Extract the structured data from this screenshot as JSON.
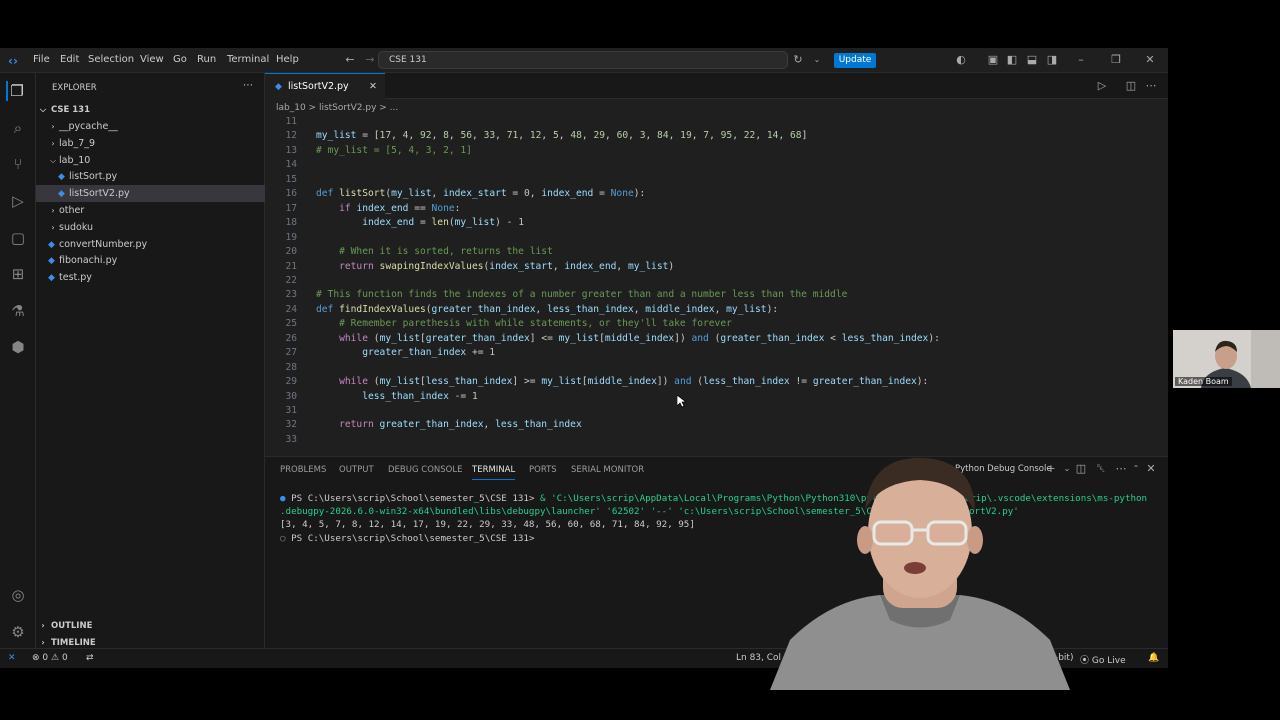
{
  "titlebar": {
    "menu": [
      "File",
      "Edit",
      "Selection",
      "View",
      "Go",
      "Run",
      "Terminal",
      "Help"
    ],
    "search_text": "CSE 131",
    "update_label": "Update"
  },
  "sidebar": {
    "header": "EXPLORER",
    "root": "CSE 131",
    "items": [
      {
        "label": "__pycache__",
        "kind": "folder",
        "open": false,
        "depth": 1
      },
      {
        "label": "lab_7_9",
        "kind": "folder",
        "open": false,
        "depth": 1
      },
      {
        "label": "lab_10",
        "kind": "folder",
        "open": true,
        "depth": 1
      },
      {
        "label": "listSort.py",
        "kind": "file",
        "depth": 2
      },
      {
        "label": "listSortV2.py",
        "kind": "file",
        "depth": 2,
        "selected": true
      },
      {
        "label": "other",
        "kind": "folder",
        "open": false,
        "depth": 1
      },
      {
        "label": "sudoku",
        "kind": "folder",
        "open": false,
        "depth": 1
      },
      {
        "label": "convertNumber.py",
        "kind": "file",
        "depth": 1
      },
      {
        "label": "fibonachi.py",
        "kind": "file",
        "depth": 1
      },
      {
        "label": "test.py",
        "kind": "file",
        "depth": 1
      }
    ],
    "outline": "OUTLINE",
    "timeline": "TIMELINE"
  },
  "editor": {
    "tab": "listSortV2.py",
    "breadcrumb": "lab_10 > listSortV2.py > ...",
    "lines": [
      {
        "n": "11",
        "code": ""
      },
      {
        "n": "12",
        "code": "my_list = [17, 4, 92, 8, 56, 33, 71, 12, 5, 48, 29, 60, 3, 84, 19, 7, 95, 22, 14, 68]"
      },
      {
        "n": "13",
        "code": "# my_list = [5, 4, 3, 2, 1]"
      },
      {
        "n": "14",
        "code": ""
      },
      {
        "n": "15",
        "code": ""
      },
      {
        "n": "16",
        "code": "def listSort(my_list, index_start = 0, index_end = None):"
      },
      {
        "n": "17",
        "code": "    if index_end == None:"
      },
      {
        "n": "18",
        "code": "        index_end = len(my_list) - 1"
      },
      {
        "n": "19",
        "code": ""
      },
      {
        "n": "20",
        "code": "    # When it is sorted, returns the list"
      },
      {
        "n": "21",
        "code": "    return swapingIndexValues(index_start, index_end, my_list)"
      },
      {
        "n": "22",
        "code": ""
      },
      {
        "n": "23",
        "code": "# This function finds the indexes of a number greater than and a number less than the middle"
      },
      {
        "n": "24",
        "code": "def findIndexValues(greater_than_index, less_than_index, middle_index, my_list):"
      },
      {
        "n": "25",
        "code": "    # Remember parethesis with while statements, or they'll take forever"
      },
      {
        "n": "26",
        "code": "    while (my_list[greater_than_index] <= my_list[middle_index]) and (greater_than_index < less_than_index):"
      },
      {
        "n": "27",
        "code": "        greater_than_index += 1"
      },
      {
        "n": "28",
        "code": ""
      },
      {
        "n": "29",
        "code": "    while (my_list[less_than_index] >= my_list[middle_index]) and (less_than_index != greater_than_index):"
      },
      {
        "n": "30",
        "code": "        less_than_index -= 1"
      },
      {
        "n": "31",
        "code": ""
      },
      {
        "n": "32",
        "code": "    return greater_than_index, less_than_index"
      },
      {
        "n": "33",
        "code": ""
      }
    ]
  },
  "panel": {
    "tabs": [
      "PROBLEMS",
      "OUTPUT",
      "DEBUG CONSOLE",
      "TERMINAL",
      "PORTS",
      "SERIAL MONITOR"
    ],
    "active_tab": "TERMINAL",
    "terminal_name": "Python Debug Console",
    "prompt1": "PS C:\\Users\\scrip\\School\\semester_5\\CSE 131>",
    "cmd1": " & 'C:\\Users\\scrip\\AppData\\Local\\Programs\\Python\\Python310\\pytho",
    "cmd1_tail": "scrip\\.vscode\\extensions\\ms-python",
    "cmd2": ".debugpy-2026.6.0-win32-x64\\bundled\\libs\\debugpy\\launcher' '62502' '--' 'c:\\Users\\scrip\\School\\semester_5\\CS",
    "cmd2_tail": "ortV2.py'",
    "output": "[3, 4, 5, 7, 8, 12, 14, 17, 19, 22, 29, 33, 48, 56, 60, 68, 71, 84, 92, 95]",
    "prompt2": "PS C:\\Users\\scrip\\School\\semester_5\\CSE 131>"
  },
  "statusbar": {
    "errors": "0",
    "warnings": "0",
    "cursor": "Ln 83, Col 1",
    "interpreter": "(64-bit)",
    "golive": "Go Live"
  },
  "webcam": {
    "name": "Kaden Boam"
  }
}
